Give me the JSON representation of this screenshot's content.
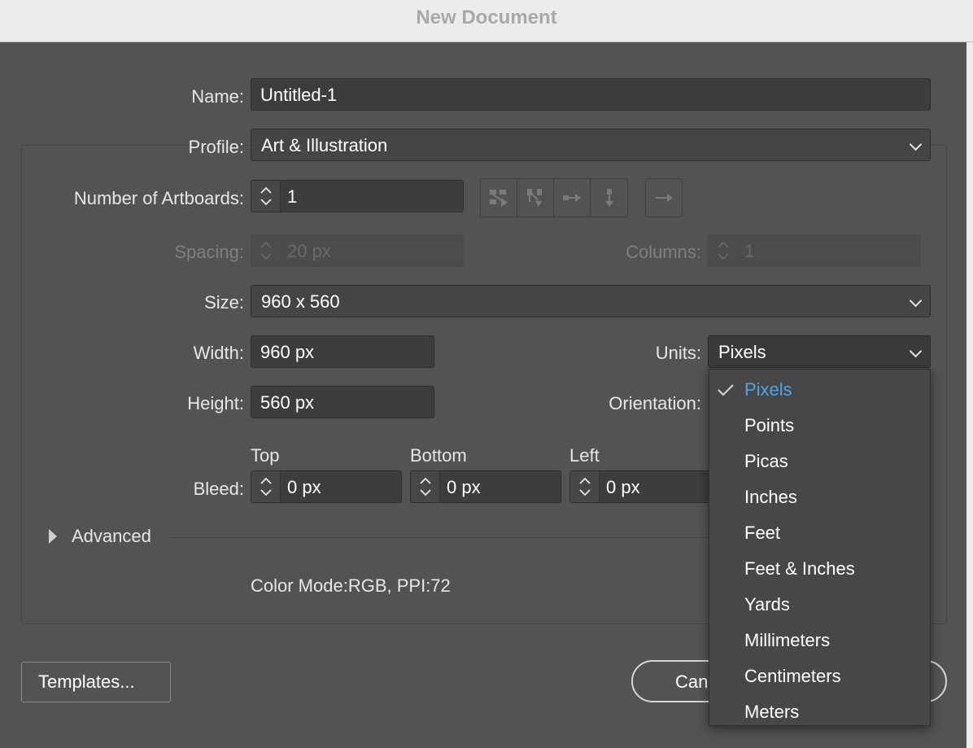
{
  "window": {
    "title": "New Document"
  },
  "labels": {
    "name": "Name:",
    "profile": "Profile:",
    "artboards": "Number of Artboards:",
    "spacing": "Spacing:",
    "columns": "Columns:",
    "size": "Size:",
    "width": "Width:",
    "height": "Height:",
    "units": "Units:",
    "orientation": "Orientation:",
    "bleed": "Bleed:",
    "bleed_top": "Top",
    "bleed_bottom": "Bottom",
    "bleed_left": "Left"
  },
  "values": {
    "name": "Untitled-1",
    "profile": "Art & Illustration",
    "artboards": "1",
    "spacing": "20 px",
    "columns": "1",
    "size": "960 x 560",
    "width": "960 px",
    "height": "560 px",
    "units": "Pixels",
    "bleed_top": "0 px",
    "bleed_bottom": "0 px",
    "bleed_left": "0 px"
  },
  "advanced": {
    "label": "Advanced"
  },
  "info": {
    "text": "Color Mode:RGB, PPI:72"
  },
  "buttons": {
    "templates": "Templates...",
    "cancel": "Can"
  },
  "units_menu": {
    "selected": "Pixels",
    "items": [
      "Pixels",
      "Points",
      "Picas",
      "Inches",
      "Feet",
      "Feet & Inches",
      "Yards",
      "Millimeters",
      "Centimeters",
      "Meters"
    ]
  },
  "colors": {
    "selected_item": "#4fa3ea",
    "panel": "#535353",
    "field": "#454545"
  }
}
